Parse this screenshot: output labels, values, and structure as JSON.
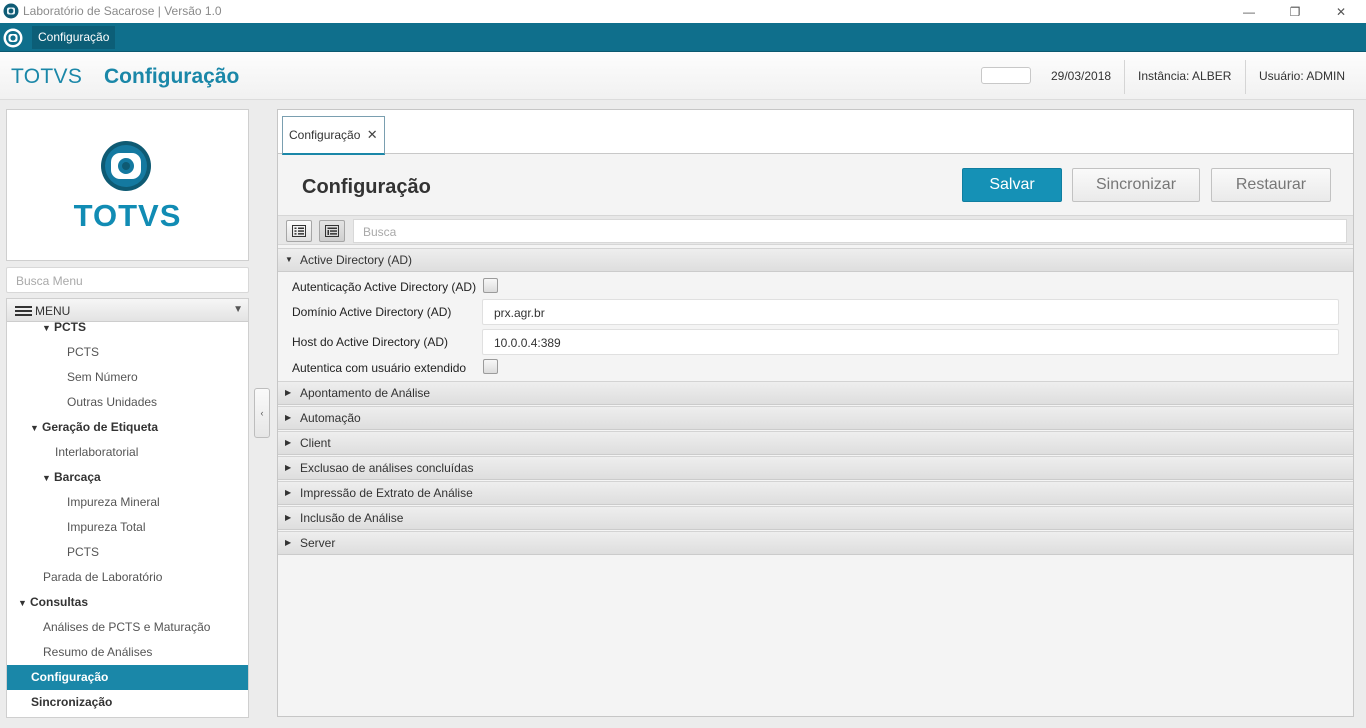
{
  "window": {
    "title": "Laboratório de Sacarose | Versão 1.0",
    "minimize_glyph": "—",
    "maximize_glyph": "❐",
    "close_glyph": "✕"
  },
  "app_menu": {
    "item": "Configuração"
  },
  "header": {
    "brand": "TOTVS",
    "page_title": "Configuração",
    "date": "29/03/2018",
    "instance": "Instância: ALBER",
    "user": "Usuário: ADMIN"
  },
  "sidebar": {
    "logo_text": "TOTVS",
    "search_placeholder": "Busca Menu",
    "menu_label": "MENU",
    "items": [
      {
        "label": "PCTS",
        "group": true
      },
      {
        "label": "PCTS"
      },
      {
        "label": "Sem Número"
      },
      {
        "label": "Outras Unidades"
      },
      {
        "label": "Geração de Etiqueta",
        "group": true
      },
      {
        "label": "Interlaboratorial"
      },
      {
        "label": "Barcaça",
        "group": true
      },
      {
        "label": "Impureza Mineral"
      },
      {
        "label": "Impureza Total"
      },
      {
        "label": "PCTS"
      },
      {
        "label": "Parada de Laboratório"
      },
      {
        "label": "Consultas",
        "group": true
      },
      {
        "label": "Análises de PCTS e Maturação"
      },
      {
        "label": "Resumo de Análises"
      },
      {
        "label": "Configuração",
        "selected": true
      },
      {
        "label": "Sincronização",
        "group": true
      }
    ]
  },
  "main": {
    "tab_label": "Configuração",
    "tab_close": "✕",
    "title": "Configuração",
    "buttons": {
      "save": "Salvar",
      "sync": "Sincronizar",
      "restore": "Restaurar"
    },
    "search_placeholder": "Busca",
    "active_section": {
      "label": "Active Directory (AD)",
      "expanded": true,
      "fields": {
        "ad_auth_label": "Autenticação Active Directory (AD)",
        "ad_auth_checked": false,
        "domain_label": "Domínio Active Directory (AD)",
        "domain_value": "prx.agr.br",
        "host_label": "Host do Active Directory (AD)",
        "host_value": "10.0.0.4:389",
        "extended_user_label": "Autentica com usuário extendido",
        "extended_user_checked": false
      }
    },
    "collapsed_sections": [
      "Apontamento de Análise",
      "Automação",
      "Client",
      "Exclusao de análises concluídas",
      "Impressão de Extrato de Análise",
      "Inclusão de Análise",
      "Server"
    ]
  },
  "colors": {
    "accent": "#1a87a8",
    "menu_strip": "#0f6f8c",
    "primary_button": "#1591b6"
  }
}
